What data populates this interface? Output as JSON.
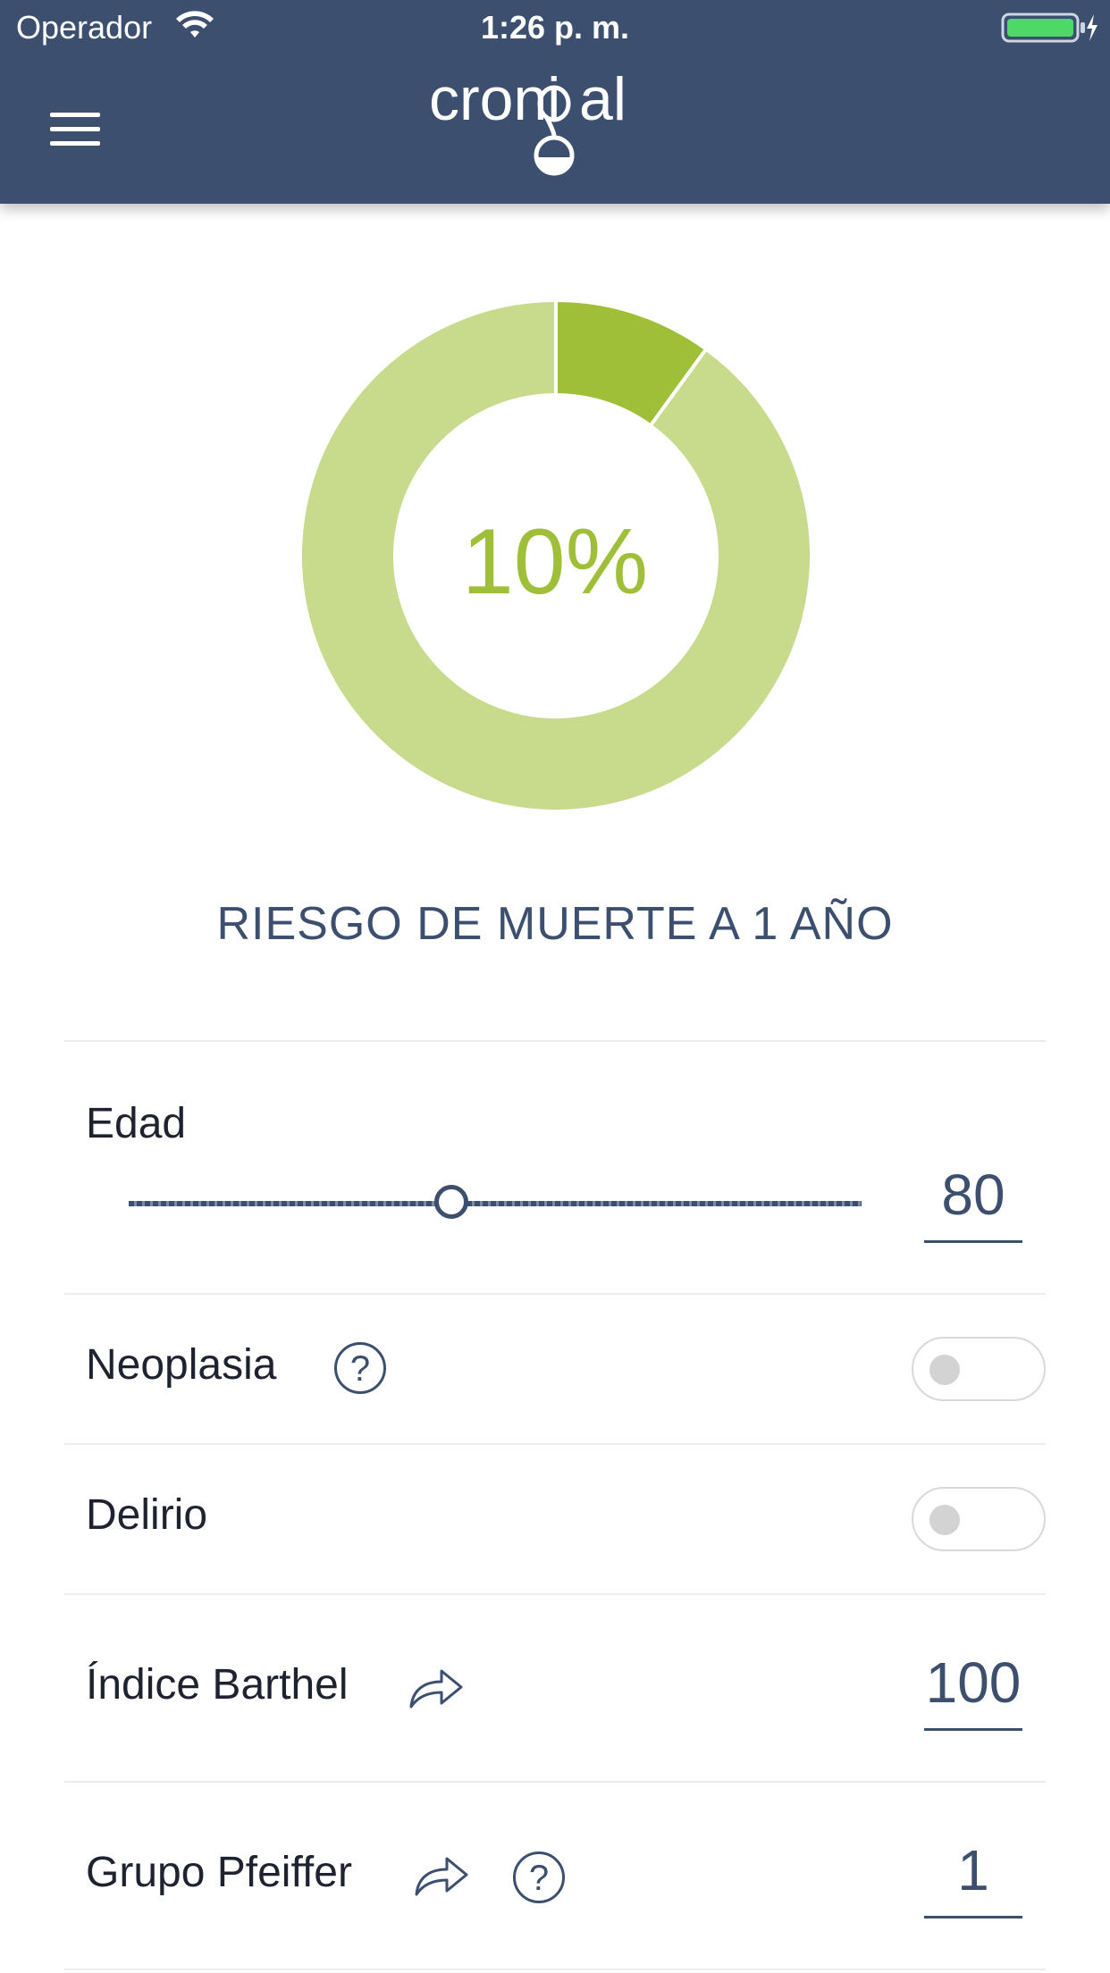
{
  "status_bar": {
    "carrier": "Operador",
    "time": "1:26 p. m."
  },
  "header": {
    "logo_text": "cronical"
  },
  "chart_data": {
    "type": "pie",
    "values": [
      10,
      90
    ],
    "colors": [
      "#a0bf38",
      "#c8da8c"
    ],
    "center_label": "10%"
  },
  "risk": {
    "value_label": "10%",
    "title": "RIESGO DE MUERTE A 1 AÑO"
  },
  "age": {
    "label": "Edad",
    "value": "80",
    "slider_fraction": 0.44
  },
  "neoplasia": {
    "label": "Neoplasia",
    "on": false
  },
  "delirio": {
    "label": "Delirio",
    "on": false
  },
  "barthel": {
    "label": "Índice Barthel",
    "value": "100"
  },
  "pfeiffer": {
    "label": "Grupo Pfeiffer",
    "value": "1"
  },
  "icons": {
    "help": "question-circle-icon",
    "link": "share-arrow-icon",
    "help_glyph": "?"
  }
}
